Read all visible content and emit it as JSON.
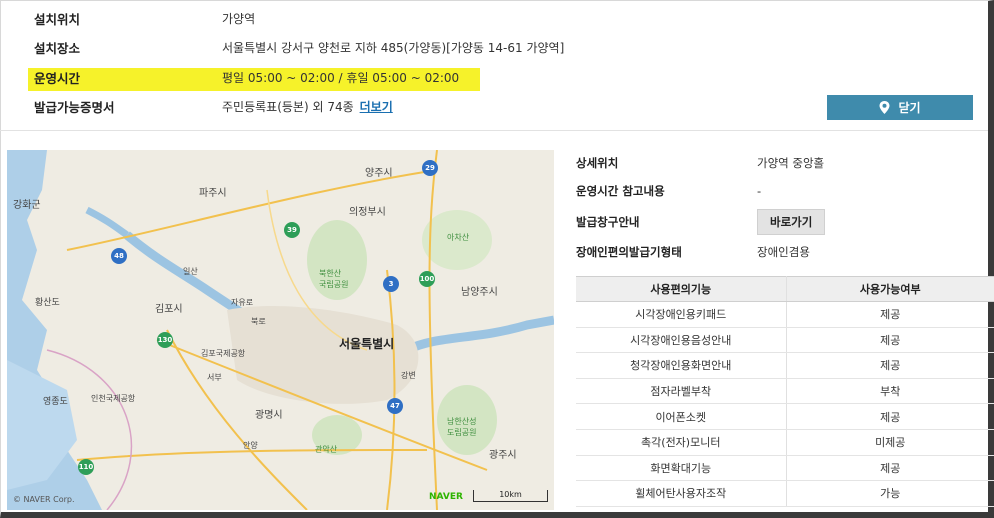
{
  "info": {
    "rows": [
      {
        "label": "설치위치",
        "value": "가양역"
      },
      {
        "label": "설치장소",
        "value": "서울특별시 강서구 양천로 지하 485(가양동)[가양동 14-61 가양역]"
      },
      {
        "label": "운영시간",
        "value": "평일 05:00 ~ 02:00 / 휴일 05:00 ~ 02:00"
      },
      {
        "label": "발급가능증명서",
        "value": "주민등록표(등본) 외 74종"
      }
    ],
    "more_link": "더보기",
    "close_button": "닫기"
  },
  "map": {
    "labels": {
      "yangju": "양주시",
      "paju": "파주시",
      "ganghwa": "강화군",
      "uijeongbu": "의정부시",
      "gimpo": "김포시",
      "namyangju": "남양주시",
      "seoul": "서울특별시",
      "gwangmyeong": "광명시",
      "gwangju": "광주시",
      "bukhansan": "북한산\n국립공원",
      "incheon_airport": "인천국제공항",
      "gimpo_airport": "김포국제공항",
      "yeongjongdo": "영종도",
      "hwangsan": "황산도",
      "ilsan": "일산",
      "jayuro": "자유로",
      "bukro": "북로",
      "gangbyeon": "강변",
      "seobu": "서부",
      "anyang": "안양",
      "achasan": "아차산",
      "gwanaksan": "관악산",
      "namhansanseong": "남한산성\n도립공원"
    },
    "route_numbers": [
      "48",
      "29",
      "39",
      "3",
      "100",
      "130",
      "47",
      "110"
    ],
    "copyright": "© NAVER Corp.",
    "brand": "NAVER",
    "scale": "10km"
  },
  "details": {
    "rows": [
      {
        "label": "상세위치",
        "value": "가양역 중앙홀"
      },
      {
        "label": "운영시간 참고내용",
        "value": "-"
      },
      {
        "label": "발급창구안내",
        "value": "바로가기"
      },
      {
        "label": "장애인편의발급기형태",
        "value": "장애인겸용"
      }
    ]
  },
  "table": {
    "headers": [
      "사용편의기능",
      "사용가능여부"
    ],
    "rows": [
      [
        "시각장애인용키패드",
        "제공"
      ],
      [
        "시각장애인용음성안내",
        "제공"
      ],
      [
        "청각장애인용화면안내",
        "제공"
      ],
      [
        "점자라벨부착",
        "부착"
      ],
      [
        "이어폰소켓",
        "제공"
      ],
      [
        "촉각(전자)모니터",
        "미제공"
      ],
      [
        "화면확대기능",
        "제공"
      ],
      [
        "휠체어탄사용자조작",
        "가능"
      ]
    ]
  }
}
